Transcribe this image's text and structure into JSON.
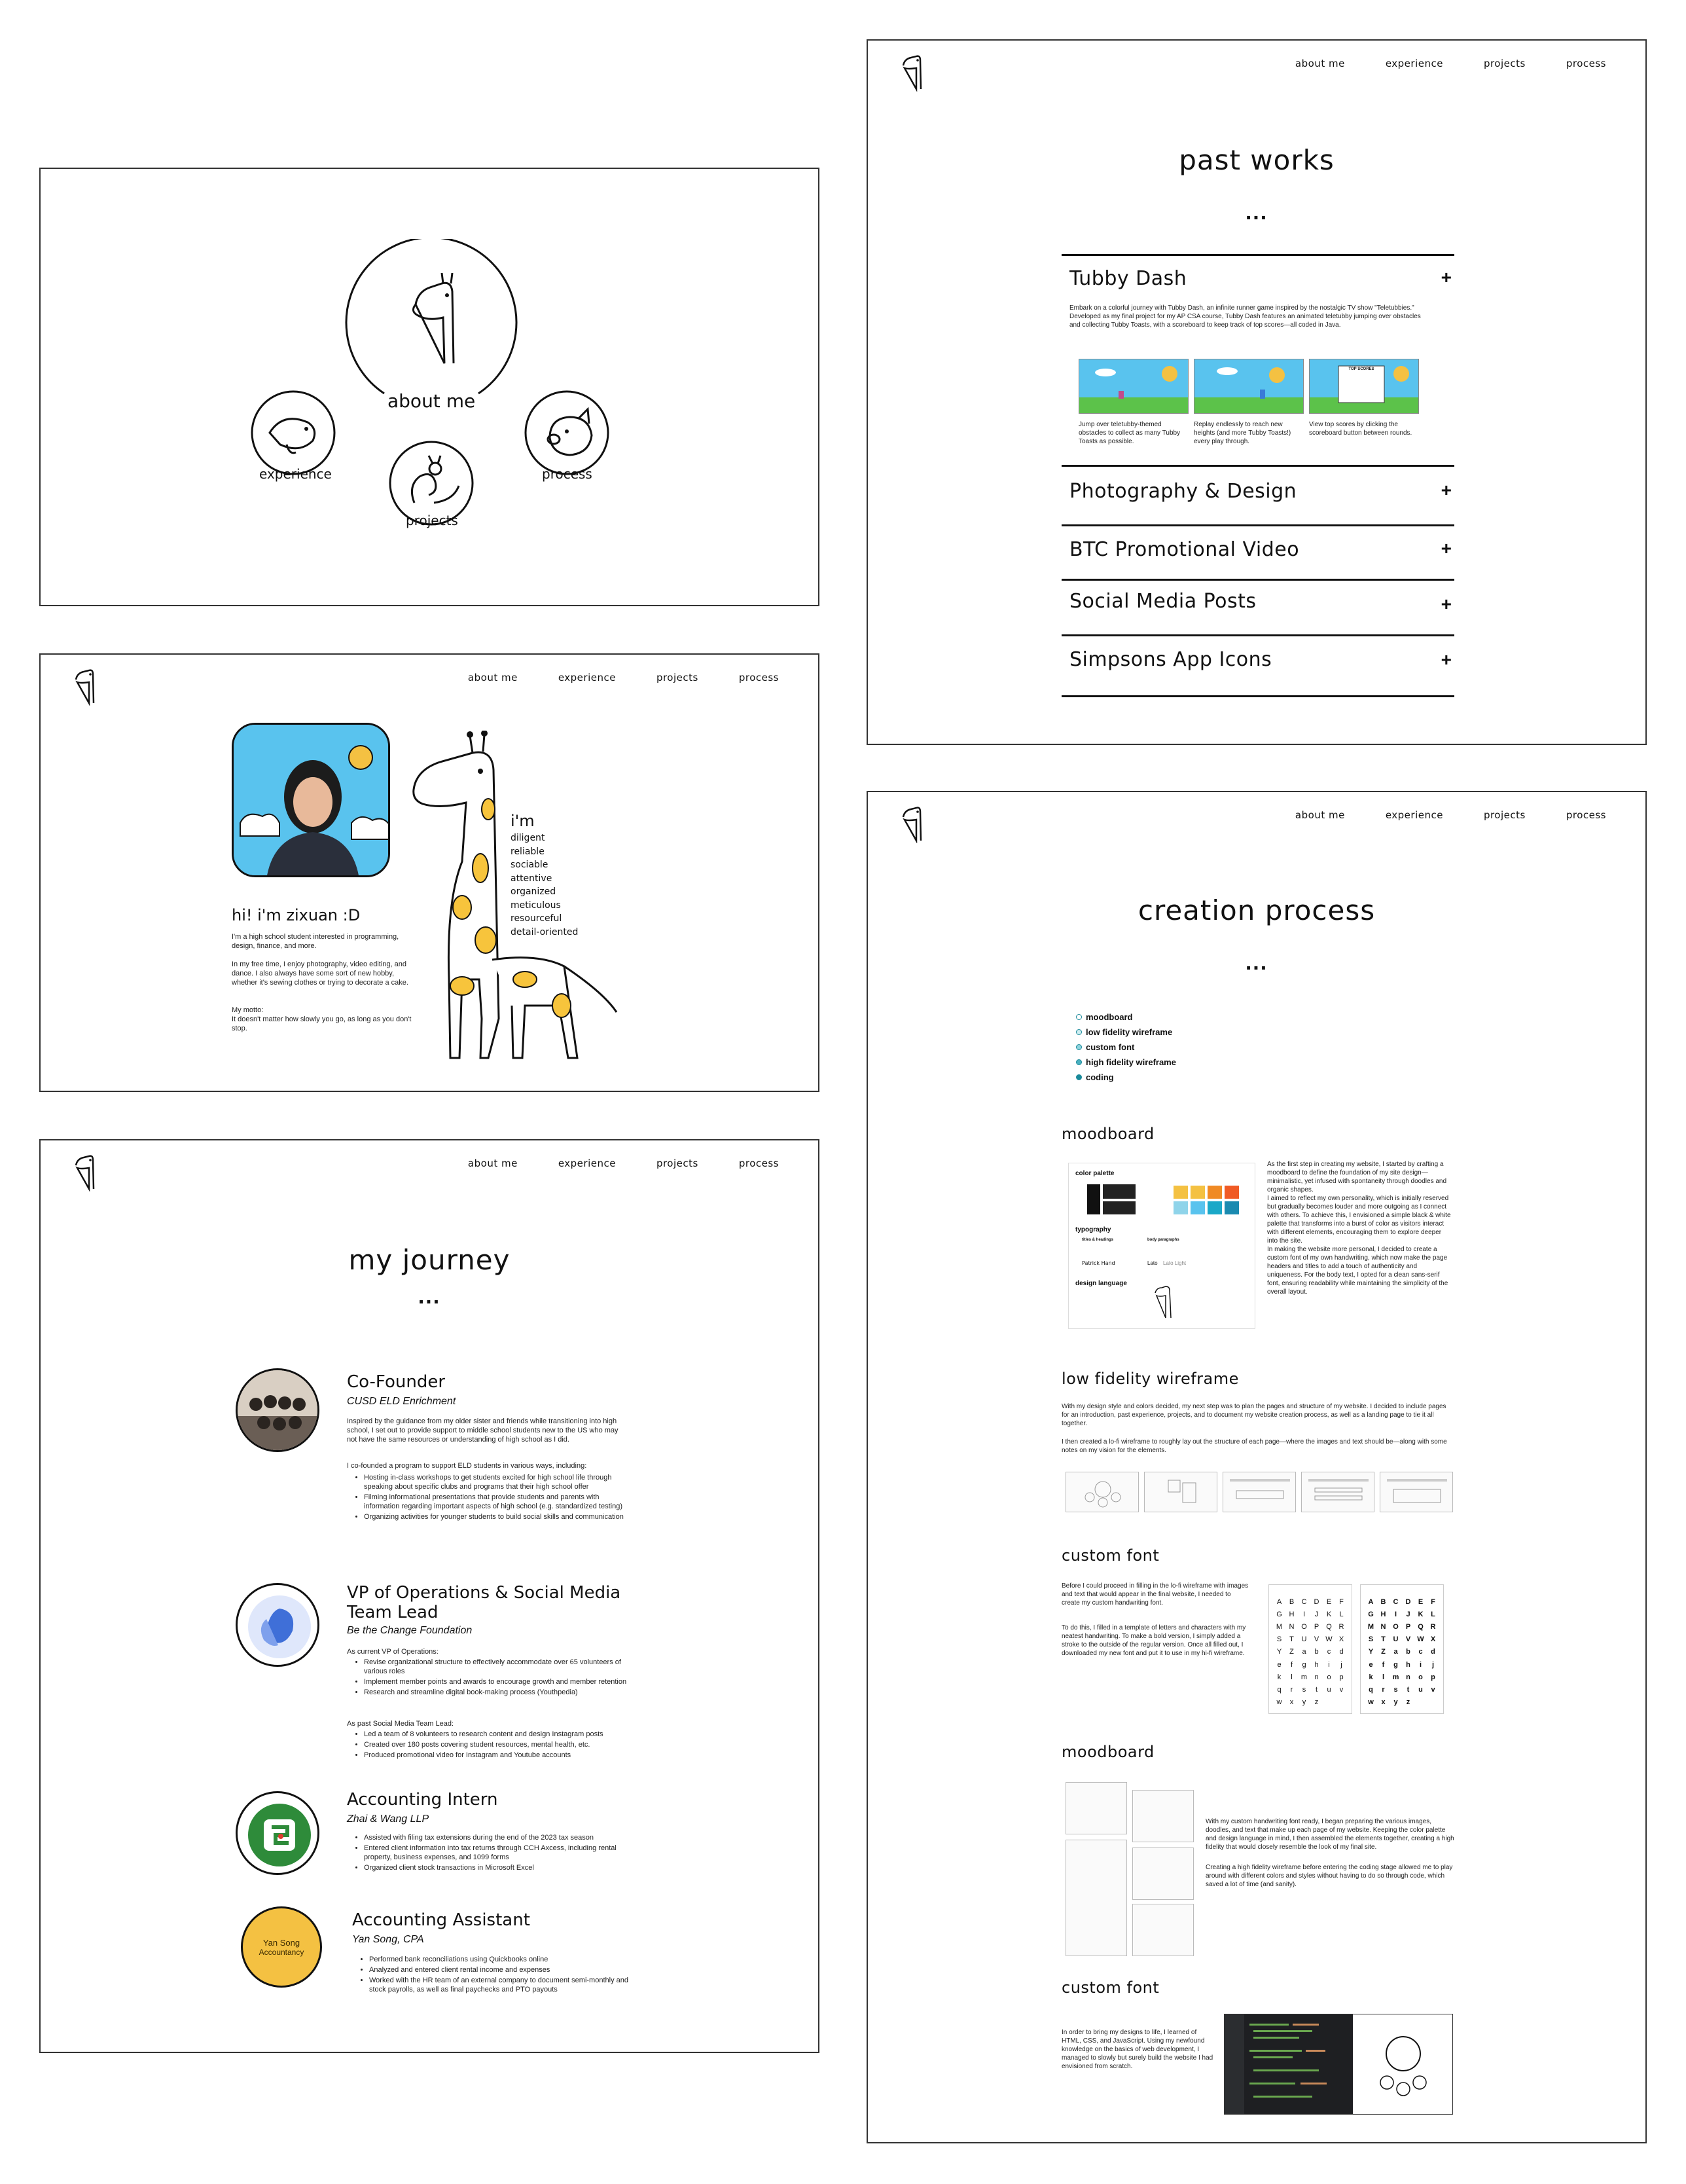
{
  "nav": {
    "about": "about me",
    "experience": "experience",
    "projects": "projects",
    "process": "process"
  },
  "landing": {
    "about_label": "about me",
    "experience_label": "experience",
    "projects_label": "projects",
    "process_label": "process"
  },
  "about": {
    "greeting": "hi! i'm zixuan :D",
    "intro": "I'm a high school student interested in programming, design, finance, and more.",
    "free_time": "In my free time, I enjoy photography, video editing, and dance. I also always have some sort of new hobby, whether it's sewing clothes or trying to decorate a cake.",
    "motto_label": "My motto:",
    "motto": "It doesn't matter how slowly you go, as long as you don't stop.",
    "im_label": "i'm",
    "traits": [
      "diligent",
      "reliable",
      "sociable",
      "attentive",
      "organized",
      "meticulous",
      "resourceful",
      "detail-oriented"
    ]
  },
  "journey": {
    "title": "my journey",
    "dots": "...",
    "entries": [
      {
        "role": "Co-Founder",
        "org": "CUSD ELD Enrichment",
        "para1": "Inspired by the guidance from my older sister and friends while transitioning into high school, I set out to provide support to middle school students new to the US who may not have the same resources or understanding of high school as I did.",
        "para2": "I co-founded a program to support ELD students in various ways, including:",
        "bullets": [
          "Hosting in-class workshops to get students excited for high school life through speaking about specific clubs and programs that their high school offer",
          "Filming informational presentations that provide students and parents with information regarding important aspects of high school (e.g. standardized testing)",
          "Organizing activities for younger students to build social skills and communication"
        ]
      },
      {
        "role": "VP of Operations & Social Media Team Lead",
        "org": "Be the Change Foundation",
        "intro1": "As current VP of Operations:",
        "bullets1": [
          "Revise organizational structure to effectively accommodate over 65 volunteers of various roles",
          "Implement member points and awards to encourage growth and member retention",
          "Research and streamline digital book-making process (Youthpedia)"
        ],
        "intro2": "As past Social Media Team Lead:",
        "bullets2": [
          "Led a team of 8 volunteers to research content and design Instagram posts",
          "Created over 180 posts covering student resources, mental health, etc.",
          "Produced promotional video for Instagram and Youtube accounts"
        ]
      },
      {
        "role": "Accounting Intern",
        "org": "Zhai & Wang LLP",
        "bullets": [
          "Assisted with filing tax extensions during the end of the 2023 tax season",
          "Entered client information into tax returns through CCH Axcess, including rental property, business expenses, and 1099 forms",
          "Organized client stock transactions in Microsoft Excel"
        ]
      },
      {
        "role": "Accounting Assistant",
        "org": "Yan Song, CPA",
        "logo_line1": "Yan Song",
        "logo_line2": "Accountancy",
        "bullets": [
          "Performed bank reconciliations using Quickbooks online",
          "Analyzed and entered client rental income and expenses",
          "Worked with the HR team of an external company to document semi-monthly and stock payrolls, as well as final paychecks and PTO payouts"
        ]
      }
    ]
  },
  "works": {
    "title": "past works",
    "dots": "...",
    "items": [
      {
        "title": "Tubby Dash",
        "plus": "+",
        "desc": "Embark on a colorful journey with Tubby Dash, an infinite runner game inspired by the nostalgic TV show \"Teletubbies.\" Developed as my final project for my AP CSA course, Tubby Dash features an animated teletubby jumping over obstacles and collecting Tubby Toasts, with a scoreboard to keep track of top scores—all coded in Java.",
        "captions": [
          "Jump over teletubby-themed obstacles to collect as many Tubby Toasts as possible.",
          "Replay endlessly to reach new heights (and more Tubby Toasts!) every play through.",
          "View top scores by clicking the scoreboard button between rounds."
        ],
        "score_label": "TOP SCORES"
      },
      {
        "title": "Photography & Design",
        "plus": "+"
      },
      {
        "title": "BTC Promotional Video",
        "plus": "+"
      },
      {
        "title": "Social Media Posts",
        "plus": "+"
      },
      {
        "title": "Simpsons App Icons",
        "plus": "+"
      }
    ]
  },
  "process": {
    "title": "creation process",
    "dots": "...",
    "toc": [
      "moodboard",
      "low fidelity wireframe",
      "custom font",
      "high fidelity wireframe",
      "coding"
    ],
    "s1_title": "moodboard",
    "s1_text": "As the first step in creating my website, I started by crafting a moodboard to define the foundation of my site design—minimalistic, yet infused with spontaneity through doodles and organic shapes.\nI aimed to reflect my own personality, which is initially reserved but gradually becomes louder and more outgoing as I connect with others. To achieve this, I envisioned a simple black & white palette that transforms into a burst of color as visitors interact with different elements, encouraging them to explore deeper into the site.\nIn making the website more personal, I decided to create a custom font of my own handwriting, which now make the page headers and titles to add a touch of authenticity and uniqueness. For the body text, I opted for a clean sans-serif font, ensuring readability while maintaining the simplicity of the overall layout.",
    "mb_color": "color palette",
    "mb_typo": "typography",
    "mb_titles": "titles & headings",
    "mb_body": "body paragraphs",
    "mb_font1": "Patrick Hand",
    "mb_font2": "Lato",
    "mb_font3": "Lato Light",
    "mb_design": "design language",
    "s2_title": "low fidelity wireframe",
    "s2_text1": "With my design style and colors decided, my next step was to plan the pages and structure of my website. I decided to include pages for an introduction, past experience, projects, and to document my website creation process, as well as a landing page to tie it all together.",
    "s2_text2": "I then created a lo-fi wireframe to roughly lay out the structure of each page—where the images and text should be—along with some notes on my vision for the elements.",
    "s3_title": "custom font",
    "s3_text1": "Before I could proceed in filling in the lo-fi wireframe with images and text that would appear in the final website, I needed to create my custom handwriting font.",
    "s3_text2": "To do this, I filled in a template of letters and characters with my neatest handwriting. To make a bold version, I simply added a stroke to the outside of the regular version. Once all filled out, I downloaded my new font and put it to use in my hi-fi wireframe.",
    "s4_title": "moodboard",
    "s4_text1": "With my custom handwriting font ready, I began preparing the various images, doodles, and text that make up each page of my website. Keeping the color palette and design language in mind, I then assembled the elements together, creating a high fidelity that would closely resemble the look of my final site.",
    "s4_text2": "Creating a high fidelity wireframe before entering the coding stage allowed me to play around with different colors and styles without having to do so through code, which saved a lot of time (and sanity).",
    "s5_title": "custom font",
    "s5_text": "In order to bring my designs to life, I learned of HTML, CSS, and JavaScript. Using my newfound knowledge on the basics of web development, I managed to slowly but surely build the website I had envisioned from scratch.",
    "glyphs": [
      "A",
      "B",
      "C",
      "D",
      "E",
      "F",
      "G",
      "H",
      "I",
      "J",
      "K",
      "L",
      "M",
      "N",
      "O",
      "P",
      "Q",
      "R",
      "S",
      "T",
      "U",
      "V",
      "W",
      "X",
      "Y",
      "Z",
      "a",
      "b",
      "c",
      "d",
      "e",
      "f",
      "g",
      "h",
      "i",
      "j",
      "k",
      "l",
      "m",
      "n",
      "o",
      "p",
      "q",
      "r",
      "s",
      "t",
      "u",
      "v",
      "w",
      "x",
      "y",
      "z"
    ]
  },
  "colors": {
    "sky": "#59c3ee",
    "yellow": "#f4c142",
    "orange": "#f08a24",
    "teal": "#1aa8c8",
    "grass": "#5cc24a",
    "giraffe_spot": "#f7c43c"
  }
}
